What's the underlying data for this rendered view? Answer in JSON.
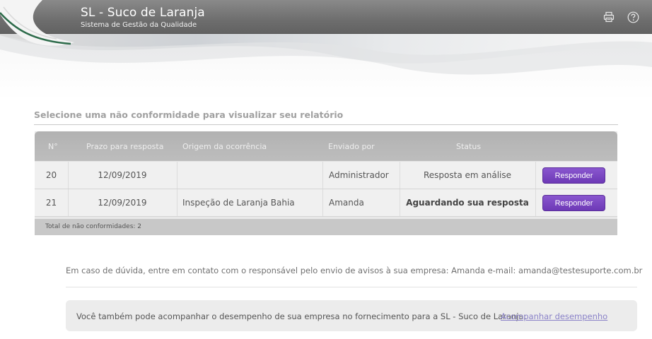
{
  "header": {
    "title": "SL - Suco de Laranja",
    "subtitle": "Sistema de Gestão da Qualidade",
    "icons": [
      "printer-icon",
      "help-icon"
    ]
  },
  "section": {
    "title": "Selecione uma não conformidade para visualizar seu relatório"
  },
  "table": {
    "columns": [
      "N°",
      "Prazo para resposta",
      "Origem da ocorrência",
      "Enviado por",
      "Status"
    ],
    "rows": [
      {
        "num": "20",
        "deadline": "12/09/2019",
        "origin": "",
        "sender": "Administrador",
        "status": "Resposta em análise",
        "status_bold": false,
        "action": "Responder"
      },
      {
        "num": "21",
        "deadline": "12/09/2019",
        "origin": "Inspeção de Laranja Bahia",
        "sender": "Amanda",
        "status": "Aguardando sua resposta",
        "status_bold": true,
        "action": "Responder"
      }
    ],
    "footer": "Total de não conformidades: 2"
  },
  "contact": {
    "text": "Em caso de dúvida, entre em contato com o responsável pelo envio de avisos à sua empresa: Amanda e-mail: amanda@testesuporte.com.br"
  },
  "performance": {
    "text": "Você também pode acompanhar o desempenho de sua empresa no fornecimento para a SL - Suco de Laranja:",
    "link": "Acompanhar desempenho"
  },
  "colors": {
    "accent_button": "#7846c2",
    "link": "#8a82c8",
    "header_bar": "#6e6e6e"
  }
}
